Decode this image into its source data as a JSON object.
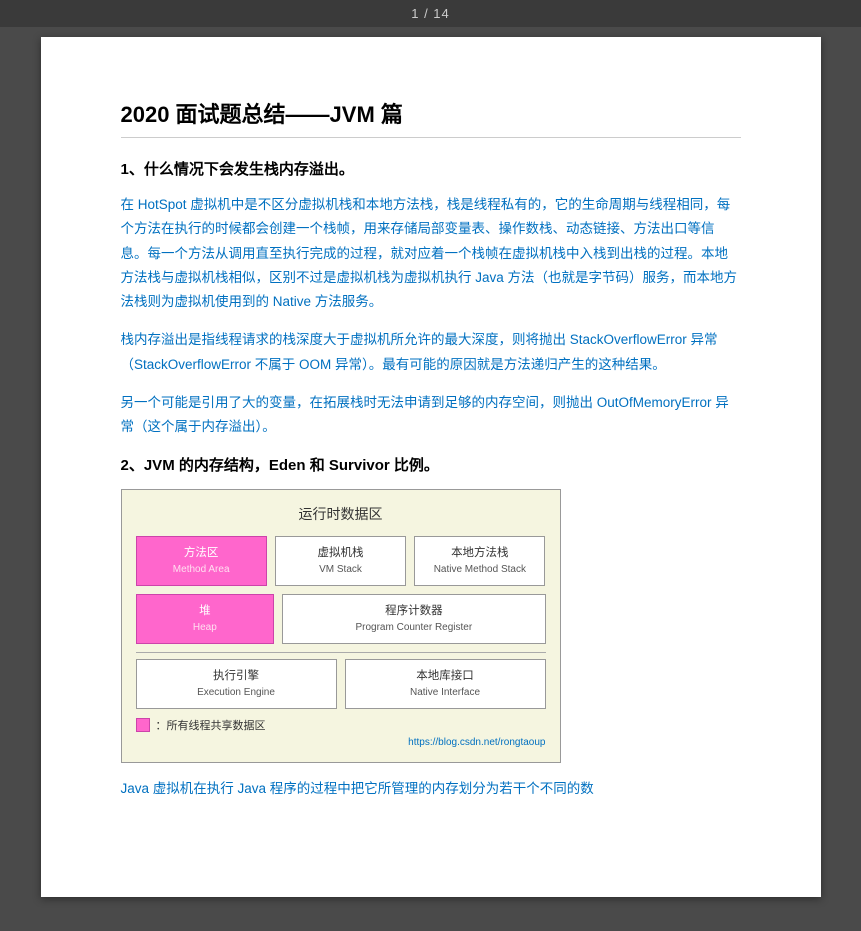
{
  "topbar": {
    "page_indicator": "1 / 14"
  },
  "document": {
    "title": "2020 面试题总结——JVM 篇",
    "section1": {
      "heading": "1、什么情况下会发生栈内存溢出。",
      "paragraphs": [
        "在 HotSpot 虚拟机中是不区分虚拟机栈和本地方法栈，栈是线程私有的，它的生命周期与线程相同，每个方法在执行的时候都会创建一个栈帧，用来存储局部变量表、操作数栈、动态链接、方法出口等信息。每一个方法从调用直至执行完成的过程，就对应着一个栈帧在虚拟机栈中入栈到出栈的过程。本地方法栈与虚拟机栈相似，区别不过是虚拟机栈为虚拟机执行 Java 方法（也就是字节码）服务，而本地方法栈则为虚拟机使用到的 Native 方法服务。",
        "栈内存溢出是指线程请求的栈深度大于虚拟机所允许的最大深度，则将抛出 StackOverflowError 异常（StackOverflowError 不属于 OOM 异常）。最有可能的原因就是方法递归产生的这种结果。",
        "另一个可能是引用了大的变量，在拓展栈时无法申请到足够的内存空间，则抛出 OutOfMemoryError 异常（这个属于内存溢出）。"
      ]
    },
    "section2": {
      "heading": "2、JVM 的内存结构，Eden 和 Survivor 比例。",
      "diagram": {
        "title": "运行时数据区",
        "rows": [
          {
            "boxes": [
              {
                "label": "方法区",
                "sublabel": "Method Area",
                "type": "pink"
              },
              {
                "label": "虚拟机栈",
                "sublabel": "VM Stack",
                "type": "normal"
              },
              {
                "label": "本地方法栈",
                "sublabel": "Native Method Stack",
                "type": "normal"
              }
            ]
          },
          {
            "boxes": [
              {
                "label": "堆",
                "sublabel": "Heap",
                "type": "pink"
              },
              {
                "label": "程序计数器",
                "sublabel": "Program Counter Register",
                "type": "normal",
                "wide": true
              }
            ]
          }
        ],
        "bottom_row": [
          {
            "label": "执行引擎",
            "sublabel": "Execution Engine",
            "type": "normal"
          },
          {
            "label": "本地库接口",
            "sublabel": "Native Interface",
            "type": "normal"
          }
        ],
        "legend_text": "：所有线程共享数据区",
        "watermark": "https://blog.csdn.net/rongtaoup"
      }
    },
    "last_paragraph": "Java 虚拟机在执行 Java 程序的过程中把它所管理的内存划分为若干个不同的数"
  }
}
